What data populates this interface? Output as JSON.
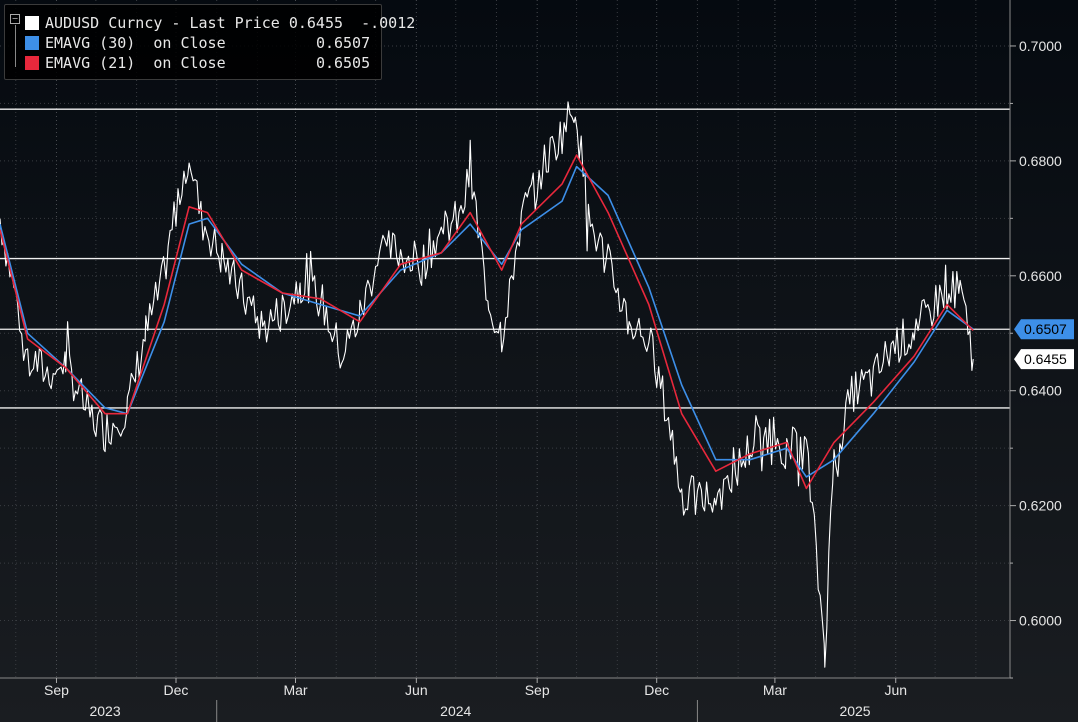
{
  "chart_data": {
    "type": "line",
    "title": "",
    "ylim": [
      0.59,
      0.708
    ],
    "y_ticks": [
      "0.6000",
      "0.6200",
      "0.6400",
      "0.6600",
      "0.6800",
      "0.7000"
    ],
    "x_month_labels": [
      "Sep",
      "Dec",
      "Mar",
      "Jun",
      "Sep",
      "Dec",
      "Mar",
      "Jun"
    ],
    "x_year_labels": [
      "2023",
      "2024",
      "2025"
    ],
    "horizontal_levels": [
      0.689,
      0.663,
      0.6507,
      0.637
    ],
    "legend": [
      {
        "label": "AUDUSD Curncy - Last Price",
        "value": "0.6455",
        "change": "-.0012",
        "color": "#ffffff"
      },
      {
        "label": "EMAVG (30)  on Close",
        "value": "0.6507",
        "color": "#3d8fe8"
      },
      {
        "label": "EMAVG (21)  on Close",
        "value": "0.6505",
        "color": "#e8283c"
      }
    ],
    "last_value_tags": [
      {
        "value": "0.6507",
        "y": 0.6507,
        "color": "#3d8fe8"
      },
      {
        "value": "0.6455",
        "y": 0.6455,
        "color": "#ffffff"
      }
    ],
    "series": [
      {
        "name": "AUDUSD Curncy",
        "color": "#ffffff",
        "x": [
          "2023-07-20",
          "2023-08-10",
          "2023-08-25",
          "2023-09-08",
          "2023-09-25",
          "2023-10-08",
          "2023-10-25",
          "2023-11-08",
          "2023-11-22",
          "2023-12-01",
          "2023-12-11",
          "2023-12-20",
          "2024-01-05",
          "2024-01-20",
          "2024-02-05",
          "2024-02-20",
          "2024-03-05",
          "2024-03-20",
          "2024-04-05",
          "2024-04-19",
          "2024-05-05",
          "2024-05-20",
          "2024-06-05",
          "2024-06-20",
          "2024-07-05",
          "2024-07-12",
          "2024-07-26",
          "2024-08-05",
          "2024-08-20",
          "2024-09-05",
          "2024-09-20",
          "2024-09-30",
          "2024-10-10",
          "2024-10-25",
          "2024-11-10",
          "2024-11-25",
          "2024-12-10",
          "2024-12-20",
          "2025-01-05",
          "2025-01-15",
          "2025-01-30",
          "2025-02-10",
          "2025-02-25",
          "2025-03-10",
          "2025-03-25",
          "2025-04-08",
          "2025-04-15",
          "2025-04-30",
          "2025-05-15",
          "2025-05-30",
          "2025-06-15",
          "2025-06-30",
          "2025-07-10",
          "2025-07-20",
          "2025-07-30"
        ],
        "values": [
          0.67,
          0.646,
          0.643,
          0.645,
          0.636,
          0.633,
          0.637,
          0.65,
          0.66,
          0.672,
          0.682,
          0.67,
          0.663,
          0.657,
          0.651,
          0.654,
          0.659,
          0.656,
          0.646,
          0.653,
          0.665,
          0.664,
          0.662,
          0.668,
          0.67,
          0.678,
          0.655,
          0.65,
          0.67,
          0.679,
          0.685,
          0.69,
          0.67,
          0.662,
          0.652,
          0.649,
          0.635,
          0.622,
          0.621,
          0.622,
          0.626,
          0.63,
          0.633,
          0.63,
          0.63,
          0.595,
          0.629,
          0.64,
          0.642,
          0.648,
          0.65,
          0.655,
          0.658,
          0.657,
          0.6455
        ]
      },
      {
        "name": "EMAVG (30)",
        "color": "#3d8fe8",
        "x": [
          "2023-07-20",
          "2023-08-10",
          "2023-09-08",
          "2023-10-08",
          "2023-10-25",
          "2023-11-22",
          "2023-12-11",
          "2023-12-25",
          "2024-01-20",
          "2024-02-20",
          "2024-03-20",
          "2024-04-19",
          "2024-05-20",
          "2024-06-20",
          "2024-07-12",
          "2024-08-05",
          "2024-08-20",
          "2024-09-20",
          "2024-10-01",
          "2024-10-25",
          "2024-11-25",
          "2024-12-20",
          "2025-01-15",
          "2025-02-10",
          "2025-03-10",
          "2025-03-25",
          "2025-04-15",
          "2025-05-15",
          "2025-06-15",
          "2025-07-10",
          "2025-07-30"
        ],
        "values": [
          0.669,
          0.65,
          0.644,
          0.637,
          0.636,
          0.652,
          0.669,
          0.67,
          0.662,
          0.657,
          0.655,
          0.653,
          0.661,
          0.664,
          0.669,
          0.662,
          0.668,
          0.673,
          0.679,
          0.674,
          0.658,
          0.641,
          0.628,
          0.628,
          0.63,
          0.625,
          0.628,
          0.636,
          0.645,
          0.654,
          0.6507
        ]
      },
      {
        "name": "EMAVG (21)",
        "color": "#e8283c",
        "x": [
          "2023-07-20",
          "2023-08-10",
          "2023-09-08",
          "2023-10-08",
          "2023-10-25",
          "2023-11-22",
          "2023-12-11",
          "2023-12-25",
          "2024-01-20",
          "2024-02-20",
          "2024-03-20",
          "2024-04-19",
          "2024-05-20",
          "2024-06-20",
          "2024-07-12",
          "2024-08-05",
          "2024-08-20",
          "2024-09-20",
          "2024-10-01",
          "2024-10-25",
          "2024-11-25",
          "2024-12-20",
          "2025-01-15",
          "2025-02-10",
          "2025-03-10",
          "2025-03-25",
          "2025-04-15",
          "2025-05-15",
          "2025-06-15",
          "2025-07-10",
          "2025-07-30"
        ],
        "values": [
          0.668,
          0.649,
          0.644,
          0.636,
          0.636,
          0.655,
          0.672,
          0.671,
          0.661,
          0.657,
          0.656,
          0.652,
          0.662,
          0.664,
          0.671,
          0.661,
          0.669,
          0.676,
          0.681,
          0.671,
          0.655,
          0.636,
          0.626,
          0.629,
          0.631,
          0.623,
          0.631,
          0.638,
          0.646,
          0.655,
          0.6505
        ]
      }
    ]
  }
}
